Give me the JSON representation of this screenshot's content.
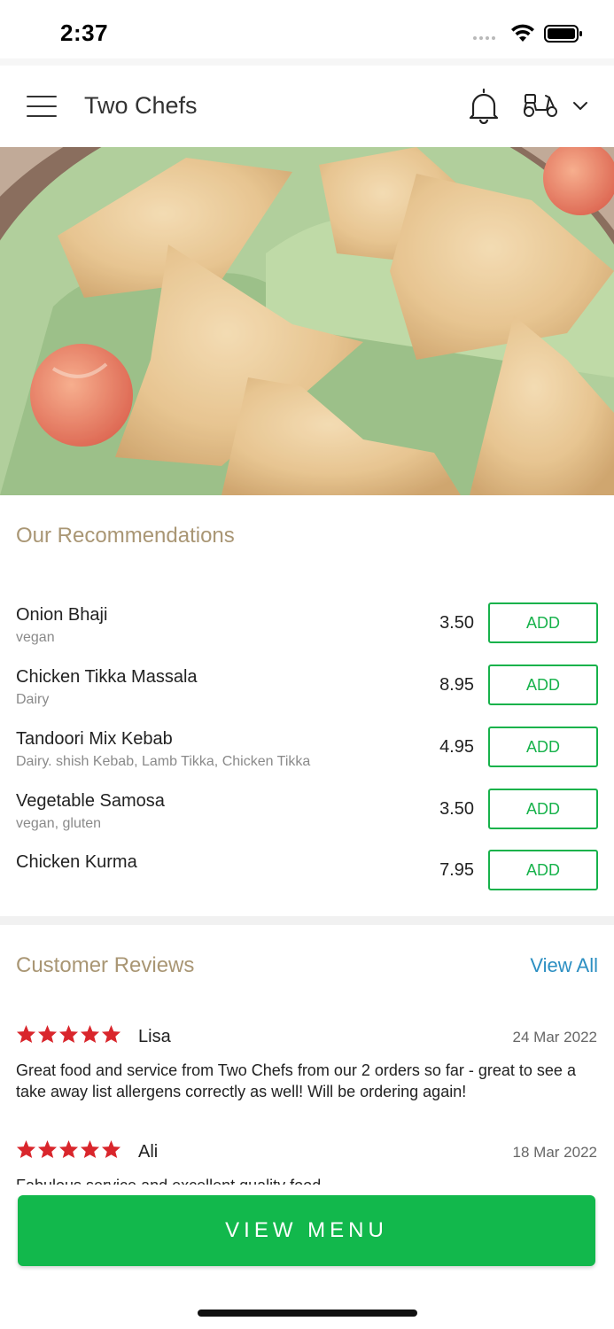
{
  "status_bar": {
    "time": "2:37"
  },
  "header": {
    "title": "Two Chefs",
    "icons": [
      "menu-icon",
      "bell-icon",
      "scooter-icon",
      "chevron-down-icon"
    ]
  },
  "hero": {
    "image": "samosa-photo"
  },
  "recommendations": {
    "title": "Our Recommendations",
    "add_label": "ADD",
    "items": [
      {
        "name": "Onion Bhaji",
        "desc": "vegan",
        "price": "3.50"
      },
      {
        "name": "Chicken Tikka Massala",
        "desc": "Dairy",
        "price": "8.95"
      },
      {
        "name": "Tandoori Mix Kebab",
        "desc": "Dairy.  shish Kebab, Lamb Tikka, Chicken Tikka",
        "price": "4.95"
      },
      {
        "name": "Vegetable Samosa",
        "desc": "vegan, gluten",
        "price": "3.50"
      },
      {
        "name": "Chicken Kurma",
        "desc": "",
        "price": "7.95"
      }
    ]
  },
  "reviews": {
    "title": "Customer Reviews",
    "view_all": "View All",
    "items": [
      {
        "name": "Lisa",
        "date": "24 Mar 2022",
        "rating": 5,
        "text": "Great food and service from Two Chefs from our 2 orders so far - great to see a take away list allergens correctly as well! Will be ordering again!"
      },
      {
        "name": "Ali",
        "date": "18 Mar 2022",
        "rating": 5,
        "text": "Fabulous service and excellent quality food"
      }
    ]
  },
  "bottom": {
    "view_menu": "VIEW MENU"
  },
  "colors": {
    "accent_green": "#12b84c",
    "section_title": "#a99674",
    "link_blue": "#2c8fc2",
    "star_red": "#d9262c"
  }
}
